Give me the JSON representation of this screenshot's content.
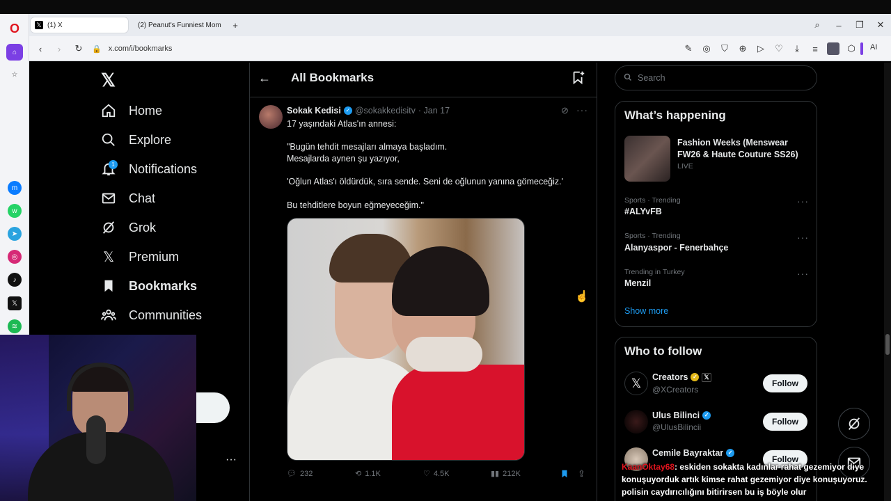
{
  "browser": {
    "tabs": [
      {
        "label": "(1) X"
      },
      {
        "label": "(2) Peanut's Funniest Mom"
      }
    ],
    "url": "x.com/i/bookmarks",
    "ai_label": "AI"
  },
  "nav": {
    "items": [
      {
        "label": "Home",
        "icon": "home-icon"
      },
      {
        "label": "Explore",
        "icon": "search-icon"
      },
      {
        "label": "Notifications",
        "icon": "bell-icon",
        "badge": "1"
      },
      {
        "label": "Chat",
        "icon": "mail-icon"
      },
      {
        "label": "Grok",
        "icon": "grok-icon"
      },
      {
        "label": "Premium",
        "icon": "x-icon"
      },
      {
        "label": "Bookmarks",
        "icon": "bookmark-icon"
      },
      {
        "label": "Communities",
        "icon": "people-icon"
      }
    ],
    "more_dots": "···"
  },
  "header": {
    "title": "All Bookmarks"
  },
  "tweet": {
    "author_name": "Sokak Kedisi",
    "handle": "@sokakkedisitv",
    "date": "· Jan 17",
    "lines": [
      "17 yaşındaki Atlas'ın annesi:",
      "\"Bugün tehdit mesajları almaya başladım.",
      "Mesajlarda aynen şu yazıyor,",
      "'Oğlun Atlas'ı öldürdük, sıra sende. Seni de oğlunun yanına gömeceğiz.'",
      "Bu tehditlere boyun eğmeyeceğim.\""
    ],
    "stats": {
      "replies": "232",
      "reposts": "1.1K",
      "likes": "4.5K",
      "views": "212K"
    }
  },
  "search": {
    "placeholder": "Search"
  },
  "happening": {
    "title": "What’s happening",
    "featured": {
      "title": "Fashion Weeks (Menswear FW26 & Haute Couture SS26)",
      "status": "LIVE"
    },
    "trends": [
      {
        "meta": "Sports · Trending",
        "name": "#ALYvFB"
      },
      {
        "meta": "Sports · Trending",
        "name": "Alanyaspor - Fenerbahçe"
      },
      {
        "meta": "Trending in Turkey",
        "name": "Menzil"
      }
    ],
    "show_more": "Show more"
  },
  "who_to_follow": {
    "title": "Who to follow",
    "accounts": [
      {
        "name": "Creators",
        "handle": "@XCreators"
      },
      {
        "name": "Ulus Bilinci",
        "handle": "@UlusBilincii"
      },
      {
        "name": "Cemile Bayraktar",
        "handle": ""
      }
    ],
    "follow_label": "Follow"
  },
  "stream_chat": {
    "username": "KaanOktay68",
    "message": ": eskiden sokakta kadınlar rahat gezemiyor diye konuşuyorduk artık kimse rahat gezemiyor diye konuşuyoruz. polisin caydırıcılığını bitirirsen bu iş böyle olur"
  },
  "colors": {
    "accent": "#1d9bf0",
    "bg": "#000000",
    "border": "#2f3336",
    "muted": "#71767b"
  }
}
